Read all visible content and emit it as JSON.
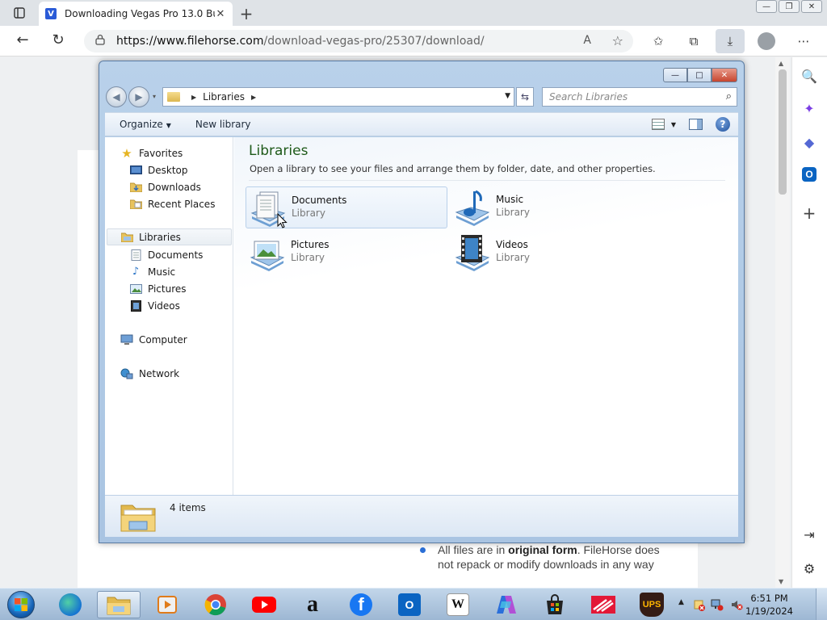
{
  "browser": {
    "tab": {
      "title": "Downloading Vegas Pro 13.0 Bu",
      "favicon_letter": "V",
      "close": "✕"
    },
    "new_tab": "+",
    "window_buttons": {
      "minimize": "—",
      "restore": "❐",
      "close": "✕"
    },
    "nav": {
      "back": "←",
      "refresh": "↻"
    },
    "url_host": "https://www.filehorse.com",
    "url_path": "/download-vegas-pro/25307/download/",
    "lock": "🔒",
    "read_aloud": "A",
    "favorite": "☆",
    "toolbar": {
      "favorites": "✩",
      "collections": "⧉",
      "downloads": "⤓",
      "menu": "⋯"
    },
    "sidebar": {
      "search": "🔍",
      "copilot": "✦",
      "games": "◆",
      "outlook": "O",
      "add": "+",
      "split": "⇥",
      "settings": "⚙"
    }
  },
  "page": {
    "bullet_prefix": "All files are in ",
    "bullet_bold": "original form",
    "bullet_suffix": ". FileHorse does not repack or modify downloads in any way"
  },
  "explorer": {
    "caption": {
      "minimize": "—",
      "maximize": "□",
      "close": "✕"
    },
    "back": "◀",
    "forward": "▶",
    "recent": "▾",
    "breadcrumb": "Libraries",
    "breadcrumb_arrow": "▶",
    "dropdown": "▼",
    "refresh": "⇆",
    "search_placeholder": "Search Libraries",
    "search_icon": "⌕",
    "commands": {
      "organize": "Organize",
      "organize_arrow": "▼",
      "new_library": "New library",
      "views_arrow": "▼",
      "help": "?"
    },
    "nav_pane": {
      "favorites": "Favorites",
      "favorites_items": [
        "Desktop",
        "Downloads",
        "Recent Places"
      ],
      "libraries": "Libraries",
      "libraries_items": [
        "Documents",
        "Music",
        "Pictures",
        "Videos"
      ],
      "computer": "Computer",
      "network": "Network"
    },
    "main": {
      "title": "Libraries",
      "description": "Open a library to see your files and arrange them by folder, date, and other properties.",
      "libraries": [
        {
          "name": "Documents",
          "kind": "Library"
        },
        {
          "name": "Music",
          "kind": "Library"
        },
        {
          "name": "Pictures",
          "kind": "Library"
        },
        {
          "name": "Videos",
          "kind": "Library"
        }
      ]
    },
    "details": {
      "count": "4 items"
    }
  },
  "taskbar": {
    "apps": [
      "file-explorer",
      "media-player",
      "chrome",
      "youtube",
      "amazon",
      "facebook",
      "outlook",
      "wikipedia",
      "copilot",
      "store",
      "bank-of-america",
      "ups"
    ],
    "wiki_label": "W",
    "ups_label": "UPS",
    "amazon_label": "a",
    "facebook_label": "f",
    "outlook_label": "O",
    "tray_arrow": "▲",
    "clock_time": "6:51 PM",
    "clock_date": "1/19/2024"
  }
}
